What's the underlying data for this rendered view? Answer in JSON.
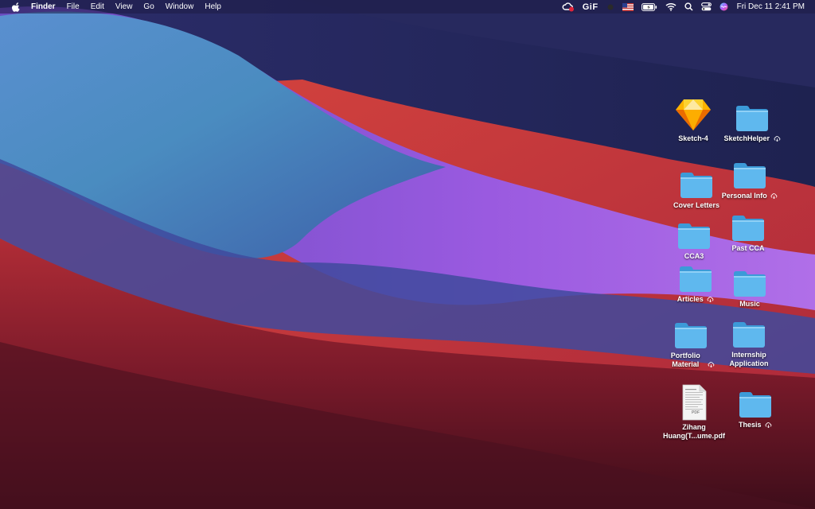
{
  "menubar": {
    "app_name": "Finder",
    "menus": [
      "File",
      "Edit",
      "View",
      "Go",
      "Window",
      "Help"
    ],
    "gif_label": "GiF",
    "clock": "Fri Dec 11  2:41 PM"
  },
  "desktop": {
    "items": [
      {
        "name": "Sketch-4",
        "type": "app",
        "cloud": false
      },
      {
        "name": "SketchHelper",
        "type": "folder",
        "cloud": true
      },
      {
        "name": "Personal Info",
        "type": "folder",
        "cloud": true
      },
      {
        "name": "Cover Letters",
        "type": "folder",
        "cloud": false
      },
      {
        "name": "CCA3",
        "type": "folder",
        "cloud": false
      },
      {
        "name": "Past CCA",
        "type": "folder",
        "cloud": false
      },
      {
        "name": "Articles",
        "type": "folder",
        "cloud": true
      },
      {
        "name": "Music",
        "type": "folder",
        "cloud": false
      },
      {
        "name": "Portfolio Material",
        "type": "folder",
        "cloud": true
      },
      {
        "name": "Internship Application",
        "type": "folder",
        "cloud": false
      },
      {
        "name": "Zihang Huang(T...ume.pdf",
        "type": "pdf",
        "cloud": false,
        "file_badge": "PDF"
      },
      {
        "name": "Thesis",
        "type": "folder",
        "cloud": true
      }
    ]
  }
}
